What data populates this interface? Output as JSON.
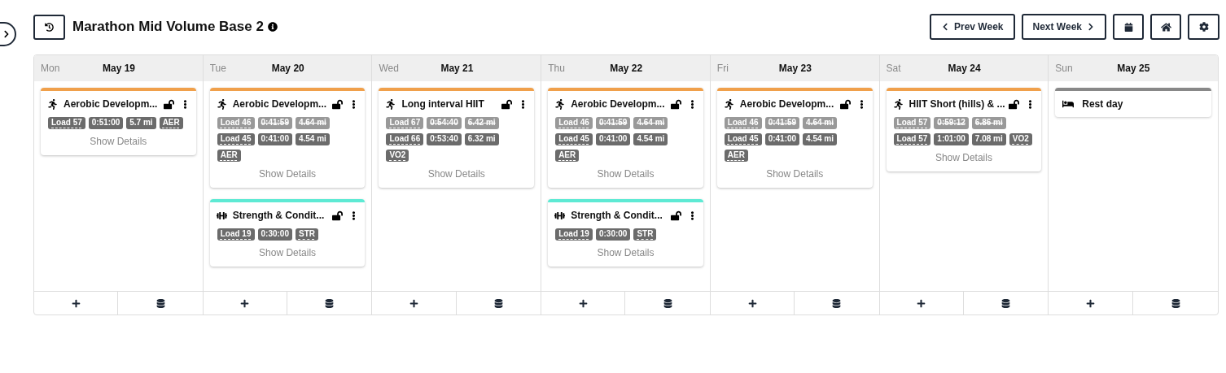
{
  "header": {
    "title": "Marathon Mid Volume Base 2",
    "buttons": [
      {
        "kind": "prev",
        "label": "Prev Week"
      },
      {
        "kind": "next",
        "label": "Next Week"
      },
      {
        "kind": "calendar"
      },
      {
        "kind": "home"
      },
      {
        "kind": "settings"
      }
    ]
  },
  "days": [
    {
      "weekday": "Mon",
      "date": "May 19",
      "cards": [
        {
          "kind": "run",
          "color": "#f0a04b",
          "title": "Aerobic Developm...",
          "details": "Show Details",
          "rows": [
            {
              "struck": false,
              "tags": [
                {
                  "text": "Load 57",
                  "underlined": true
                },
                {
                  "text": "0:51:00",
                  "underlined": false
                },
                {
                  "text": "5.7 mi",
                  "underlined": false
                },
                {
                  "text": "AER",
                  "underlined": true
                }
              ]
            }
          ]
        }
      ]
    },
    {
      "weekday": "Tue",
      "date": "May 20",
      "cards": [
        {
          "kind": "run",
          "color": "#f0a04b",
          "title": "Aerobic Developm...",
          "details": "Show Details",
          "rows": [
            {
              "struck": true,
              "tags": [
                {
                  "text": "Load 46",
                  "underlined": true
                },
                {
                  "text": "0:41:59",
                  "underlined": false
                },
                {
                  "text": "4.64 mi",
                  "underlined": false
                }
              ]
            },
            {
              "struck": false,
              "tags": [
                {
                  "text": "Load 45",
                  "underlined": true
                },
                {
                  "text": "0:41:00",
                  "underlined": false
                },
                {
                  "text": "4.54 mi",
                  "underlined": false
                }
              ]
            },
            {
              "struck": false,
              "tags": [
                {
                  "text": "AER",
                  "underlined": true
                }
              ]
            }
          ]
        },
        {
          "kind": "strength",
          "color": "#5eead4",
          "title": "Strength & Condit...",
          "details": "Show Details",
          "rows": [
            {
              "struck": false,
              "tags": [
                {
                  "text": "Load 19",
                  "underlined": true
                },
                {
                  "text": "0:30:00",
                  "underlined": false
                },
                {
                  "text": "STR",
                  "underlined": true
                }
              ]
            }
          ]
        }
      ]
    },
    {
      "weekday": "Wed",
      "date": "May 21",
      "cards": [
        {
          "kind": "run",
          "color": "#f0a04b",
          "title": "Long interval HIIT",
          "details": "Show Details",
          "rows": [
            {
              "struck": true,
              "tags": [
                {
                  "text": "Load 67",
                  "underlined": true
                },
                {
                  "text": "0:54:40",
                  "underlined": false
                },
                {
                  "text": "6.42 mi",
                  "underlined": false
                }
              ]
            },
            {
              "struck": false,
              "tags": [
                {
                  "text": "Load 66",
                  "underlined": true
                },
                {
                  "text": "0:53:40",
                  "underlined": false
                },
                {
                  "text": "6.32 mi",
                  "underlined": false
                }
              ]
            },
            {
              "struck": false,
              "tags": [
                {
                  "text": "VO2",
                  "underlined": true
                }
              ]
            }
          ]
        }
      ]
    },
    {
      "weekday": "Thu",
      "date": "May 22",
      "cards": [
        {
          "kind": "run",
          "color": "#f0a04b",
          "title": "Aerobic Developm...",
          "details": "Show Details",
          "rows": [
            {
              "struck": true,
              "tags": [
                {
                  "text": "Load 46",
                  "underlined": true
                },
                {
                  "text": "0:41:59",
                  "underlined": false
                },
                {
                  "text": "4.64 mi",
                  "underlined": false
                }
              ]
            },
            {
              "struck": false,
              "tags": [
                {
                  "text": "Load 45",
                  "underlined": true
                },
                {
                  "text": "0:41:00",
                  "underlined": false
                },
                {
                  "text": "4.54 mi",
                  "underlined": false
                }
              ]
            },
            {
              "struck": false,
              "tags": [
                {
                  "text": "AER",
                  "underlined": true
                }
              ]
            }
          ]
        },
        {
          "kind": "strength",
          "color": "#5eead4",
          "title": "Strength & Condit...",
          "details": "Show Details",
          "rows": [
            {
              "struck": false,
              "tags": [
                {
                  "text": "Load 19",
                  "underlined": true
                },
                {
                  "text": "0:30:00",
                  "underlined": false
                },
                {
                  "text": "STR",
                  "underlined": true
                }
              ]
            }
          ]
        }
      ]
    },
    {
      "weekday": "Fri",
      "date": "May 23",
      "cards": [
        {
          "kind": "run",
          "color": "#f0a04b",
          "title": "Aerobic Developm...",
          "details": "Show Details",
          "rows": [
            {
              "struck": true,
              "tags": [
                {
                  "text": "Load 46",
                  "underlined": true
                },
                {
                  "text": "0:41:59",
                  "underlined": false
                },
                {
                  "text": "4.64 mi",
                  "underlined": false
                }
              ]
            },
            {
              "struck": false,
              "tags": [
                {
                  "text": "Load 45",
                  "underlined": true
                },
                {
                  "text": "0:41:00",
                  "underlined": false
                },
                {
                  "text": "4.54 mi",
                  "underlined": false
                }
              ]
            },
            {
              "struck": false,
              "tags": [
                {
                  "text": "AER",
                  "underlined": true
                }
              ]
            }
          ]
        }
      ]
    },
    {
      "weekday": "Sat",
      "date": "May 24",
      "cards": [
        {
          "kind": "run",
          "color": "#f0a04b",
          "title": "HIIT Short (hills) & ...",
          "details": "Show Details",
          "rows": [
            {
              "struck": true,
              "tags": [
                {
                  "text": "Load 57",
                  "underlined": true
                },
                {
                  "text": "0:59:12",
                  "underlined": false
                },
                {
                  "text": "6.86 mi",
                  "underlined": false
                }
              ]
            },
            {
              "struck": false,
              "tags": [
                {
                  "text": "Load 57",
                  "underlined": true
                },
                {
                  "text": "1:01:00",
                  "underlined": false
                },
                {
                  "text": "7.08 mi",
                  "underlined": false
                },
                {
                  "text": "VO2",
                  "underlined": true
                }
              ]
            }
          ]
        }
      ]
    },
    {
      "weekday": "Sun",
      "date": "May 25",
      "cards": [
        {
          "kind": "rest",
          "color": "#888888",
          "title": "Rest day"
        }
      ]
    }
  ]
}
